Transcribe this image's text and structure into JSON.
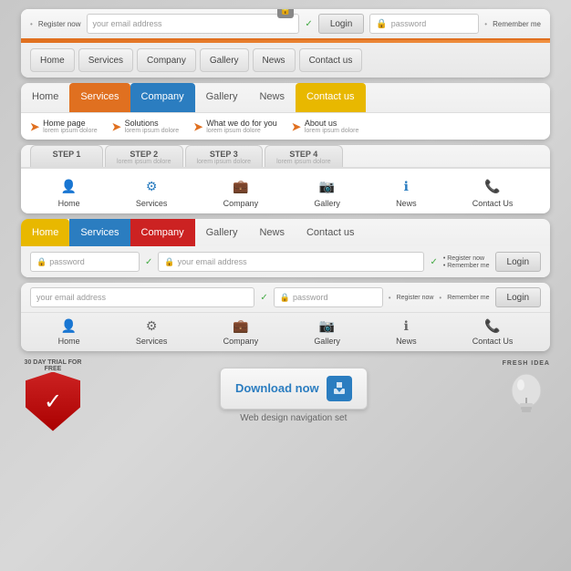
{
  "nav1": {
    "register_label": "Register now",
    "email_placeholder": "your email address",
    "login_btn": "Login",
    "password_placeholder": "password",
    "remember_label": "Remember me",
    "nav_items": [
      "Home",
      "Services",
      "Company",
      "Gallery",
      "News",
      "Contact us"
    ]
  },
  "nav2": {
    "items": [
      {
        "label": "Home",
        "style": "normal"
      },
      {
        "label": "Services",
        "style": "orange"
      },
      {
        "label": "Company",
        "style": "blue"
      },
      {
        "label": "Gallery",
        "style": "normal"
      },
      {
        "label": "News",
        "style": "normal"
      },
      {
        "label": "Contact us",
        "style": "yellow"
      }
    ],
    "links": [
      {
        "label": "Home page",
        "sub": "lorem ipsum dolore"
      },
      {
        "label": "Solutions",
        "sub": "lorem ipsum dolore"
      },
      {
        "label": "What we do for you",
        "sub": "lorem ipsum dolore"
      },
      {
        "label": "About us",
        "sub": "lorem ipsum dolore"
      }
    ]
  },
  "nav3": {
    "steps": [
      {
        "num": "STEP 1",
        "sub": ""
      },
      {
        "num": "STEP 2",
        "sub": "lorem ipsum dolore"
      },
      {
        "num": "STEP 3",
        "sub": "lorem ipsum dolore"
      },
      {
        "num": "STEP 4",
        "sub": "lorem ipsum dolore"
      }
    ],
    "items": [
      "Home",
      "Services",
      "Company",
      "Gallery",
      "News",
      "Contact Us"
    ]
  },
  "nav4": {
    "items": [
      {
        "label": "Home",
        "style": "yellow"
      },
      {
        "label": "Services",
        "style": "blue"
      },
      {
        "label": "Company",
        "style": "red"
      },
      {
        "label": "Gallery",
        "style": "normal"
      },
      {
        "label": "News",
        "style": "normal"
      },
      {
        "label": "Contact us",
        "style": "normal"
      }
    ],
    "password_placeholder": "password",
    "email_placeholder": "your email address",
    "register_label": "Register now",
    "remember_label": "Remember me",
    "login_btn": "Login"
  },
  "nav5": {
    "email_placeholder": "your email address",
    "password_placeholder": "password",
    "register_label": "Register now",
    "remember_label": "Remember me",
    "login_btn": "Login",
    "items": [
      "Home",
      "Services",
      "Company",
      "Gallery",
      "News",
      "Contact Us"
    ]
  },
  "bottom": {
    "trial_text": "30 DAY TRIAL FOR FREE",
    "download_btn": "Download now",
    "fresh_idea": "FRESH IDEA",
    "footer": "Web design navigation set"
  },
  "icons": {
    "home": "👤",
    "services": "⚙",
    "company": "💼",
    "gallery": "📷",
    "news": "ℹ",
    "contact": "📞"
  }
}
